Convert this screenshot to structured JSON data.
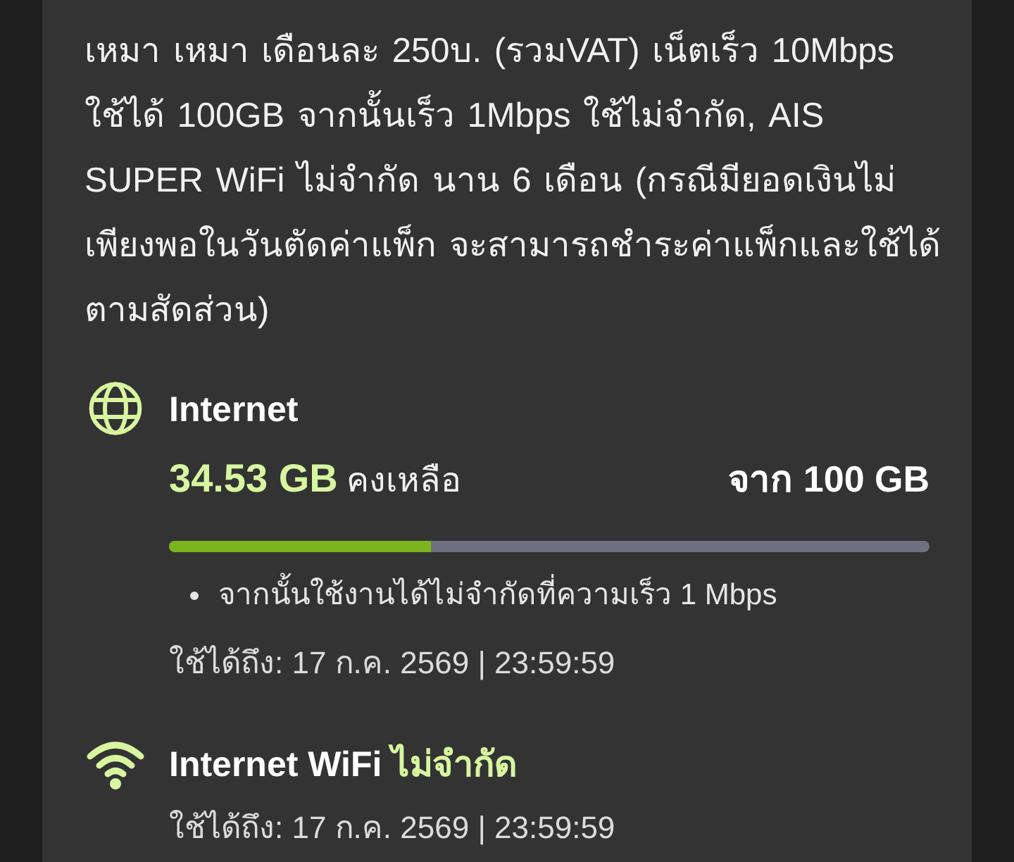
{
  "description": "เหมา เหมา เดือนละ 250บ. (รวมVAT) เน็ตเร็ว 10Mbps ใช้ได้ 100GB จากนั้นเร็ว 1Mbps ใช้ไม่จำกัด, AIS SUPER WiFi ไม่จำกัด นาน 6 เดือน (กรณีมียอดเงินไม่เพียงพอในวันตัดค่าแพ็ก จะสามารถชำระค่าแพ็กและใช้ได้ตามสัดส่วน)",
  "packages": [
    {
      "kind": "data",
      "title": "Internet",
      "remaining": "34.53 GB",
      "remaining_label": "คงเหลือ",
      "total": "จาก 100 GB",
      "level": 0.3453,
      "notes": [
        "จากนั้นใช้งานได้ไม่จำกัดที่ความเร็ว 1 Mbps"
      ],
      "validity": "ใช้ได้ถึง: 17 ก.ค. 2569 | 23:59:59"
    },
    {
      "kind": "wifi",
      "title": "Internet WiFi",
      "status": "ไม่จำกัด",
      "validity": "ใช้ได้ถึง: 17 ก.ค. 2569 | 23:59:59"
    }
  ]
}
